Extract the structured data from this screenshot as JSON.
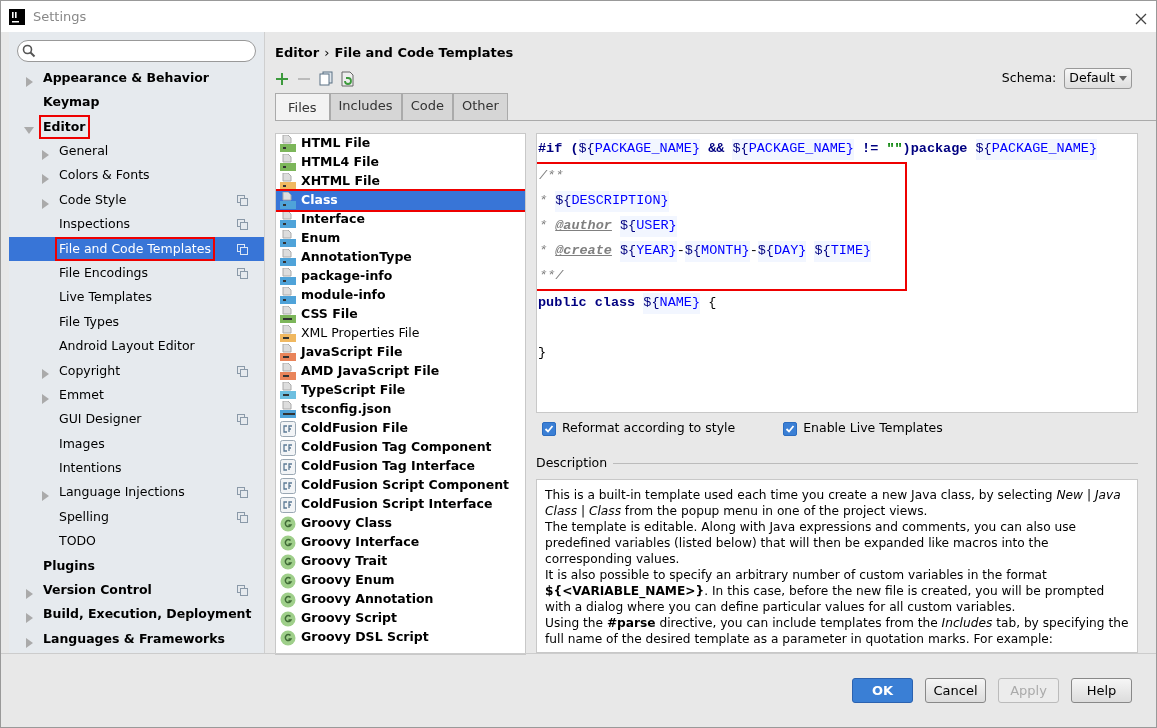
{
  "window": {
    "title": "Settings"
  },
  "sidebar": {
    "items": [
      {
        "label": "Appearance & Behavior",
        "kind": "group",
        "expanded": false,
        "project": false,
        "selected": false,
        "highlighted": false
      },
      {
        "label": "Keymap",
        "kind": "leaf",
        "project": false,
        "selected": false,
        "highlighted": false
      },
      {
        "label": "Editor",
        "kind": "group",
        "expanded": true,
        "project": false,
        "selected": false,
        "highlighted": true,
        "children": [
          {
            "label": "General",
            "kind": "group",
            "expanded": false,
            "project": false,
            "selected": false,
            "highlighted": false
          },
          {
            "label": "Colors & Fonts",
            "kind": "group",
            "expanded": false,
            "project": false,
            "selected": false,
            "highlighted": false
          },
          {
            "label": "Code Style",
            "kind": "group",
            "expanded": false,
            "project": true,
            "selected": false,
            "highlighted": false
          },
          {
            "label": "Inspections",
            "kind": "leaf",
            "project": true,
            "selected": false,
            "highlighted": false
          },
          {
            "label": "File and Code Templates",
            "kind": "leaf",
            "project": true,
            "selected": true,
            "highlighted": true
          },
          {
            "label": "File Encodings",
            "kind": "leaf",
            "project": true,
            "selected": false,
            "highlighted": false
          },
          {
            "label": "Live Templates",
            "kind": "leaf",
            "project": false,
            "selected": false,
            "highlighted": false
          },
          {
            "label": "File Types",
            "kind": "leaf",
            "project": false,
            "selected": false,
            "highlighted": false
          },
          {
            "label": "Android Layout Editor",
            "kind": "leaf",
            "project": false,
            "selected": false,
            "highlighted": false
          },
          {
            "label": "Copyright",
            "kind": "group",
            "expanded": false,
            "project": true,
            "selected": false,
            "highlighted": false
          },
          {
            "label": "Emmet",
            "kind": "group",
            "expanded": false,
            "project": false,
            "selected": false,
            "highlighted": false
          },
          {
            "label": "GUI Designer",
            "kind": "leaf",
            "project": true,
            "selected": false,
            "highlighted": false
          },
          {
            "label": "Images",
            "kind": "leaf",
            "project": false,
            "selected": false,
            "highlighted": false
          },
          {
            "label": "Intentions",
            "kind": "leaf",
            "project": false,
            "selected": false,
            "highlighted": false
          },
          {
            "label": "Language Injections",
            "kind": "group",
            "expanded": false,
            "project": true,
            "selected": false,
            "highlighted": false
          },
          {
            "label": "Spelling",
            "kind": "leaf",
            "project": true,
            "selected": false,
            "highlighted": false
          },
          {
            "label": "TODO",
            "kind": "leaf",
            "project": false,
            "selected": false,
            "highlighted": false
          }
        ]
      },
      {
        "label": "Plugins",
        "kind": "leaf",
        "project": false,
        "selected": false,
        "highlighted": false
      },
      {
        "label": "Version Control",
        "kind": "group",
        "expanded": false,
        "project": true,
        "selected": false,
        "highlighted": false
      },
      {
        "label": "Build, Execution, Deployment",
        "kind": "group",
        "expanded": false,
        "project": false,
        "selected": false,
        "highlighted": false
      },
      {
        "label": "Languages & Frameworks",
        "kind": "group",
        "expanded": false,
        "project": false,
        "selected": false,
        "highlighted": false
      }
    ]
  },
  "breadcrumb": [
    "Editor",
    "›",
    "File and Code Templates"
  ],
  "schema": {
    "label": "Schema:",
    "value": "Default"
  },
  "tabs": [
    {
      "label": "Files",
      "selected": true
    },
    {
      "label": "Includes",
      "selected": false
    },
    {
      "label": "Code",
      "selected": false
    },
    {
      "label": "Other",
      "selected": false
    }
  ],
  "templates": [
    {
      "label": "HTML File",
      "kind": "html",
      "bold": true,
      "selected": false,
      "highlighted": false
    },
    {
      "label": "HTML4 File",
      "kind": "html",
      "bold": true,
      "selected": false,
      "highlighted": false
    },
    {
      "label": "XHTML File",
      "kind": "xhtml",
      "bold": true,
      "selected": false,
      "highlighted": false
    },
    {
      "label": "Class",
      "kind": "java",
      "bold": true,
      "selected": true,
      "highlighted": true
    },
    {
      "label": "Interface",
      "kind": "java",
      "bold": true,
      "selected": false,
      "highlighted": false
    },
    {
      "label": "Enum",
      "kind": "java",
      "bold": true,
      "selected": false,
      "highlighted": false
    },
    {
      "label": "AnnotationType",
      "kind": "java",
      "bold": true,
      "selected": false,
      "highlighted": false
    },
    {
      "label": "package-info",
      "kind": "java",
      "bold": true,
      "selected": false,
      "highlighted": false
    },
    {
      "label": "module-info",
      "kind": "java",
      "bold": true,
      "selected": false,
      "highlighted": false
    },
    {
      "label": "CSS File",
      "kind": "css",
      "bold": true,
      "selected": false,
      "highlighted": false
    },
    {
      "label": "XML Properties File",
      "kind": "xml",
      "bold": false,
      "selected": false,
      "highlighted": false
    },
    {
      "label": "JavaScript File",
      "kind": "js",
      "bold": true,
      "selected": false,
      "highlighted": false
    },
    {
      "label": "AMD JavaScript File",
      "kind": "js",
      "bold": true,
      "selected": false,
      "highlighted": false
    },
    {
      "label": "TypeScript File",
      "kind": "ts",
      "bold": true,
      "selected": false,
      "highlighted": false
    },
    {
      "label": "tsconfig.json",
      "kind": "json",
      "bold": true,
      "selected": false,
      "highlighted": false
    },
    {
      "label": "ColdFusion File",
      "kind": "cf",
      "bold": true,
      "selected": false,
      "highlighted": false
    },
    {
      "label": "ColdFusion Tag Component",
      "kind": "cf",
      "bold": true,
      "selected": false,
      "highlighted": false
    },
    {
      "label": "ColdFusion Tag Interface",
      "kind": "cf",
      "bold": true,
      "selected": false,
      "highlighted": false
    },
    {
      "label": "ColdFusion Script Component",
      "kind": "cf",
      "bold": true,
      "selected": false,
      "highlighted": false
    },
    {
      "label": "ColdFusion Script Interface",
      "kind": "cf",
      "bold": true,
      "selected": false,
      "highlighted": false
    },
    {
      "label": "Groovy Class",
      "kind": "groovy",
      "bold": true,
      "selected": false,
      "highlighted": false
    },
    {
      "label": "Groovy Interface",
      "kind": "groovy",
      "bold": true,
      "selected": false,
      "highlighted": false
    },
    {
      "label": "Groovy Trait",
      "kind": "groovy",
      "bold": true,
      "selected": false,
      "highlighted": false
    },
    {
      "label": "Groovy Enum",
      "kind": "groovy",
      "bold": true,
      "selected": false,
      "highlighted": false
    },
    {
      "label": "Groovy Annotation",
      "kind": "groovy",
      "bold": true,
      "selected": false,
      "highlighted": false
    },
    {
      "label": "Groovy Script",
      "kind": "groovy",
      "bold": true,
      "selected": false,
      "highlighted": false
    },
    {
      "label": "Groovy DSL Script",
      "kind": "groovy",
      "bold": true,
      "selected": false,
      "highlighted": false
    }
  ],
  "code": {
    "lines": [
      {
        "framed": false,
        "tokens": [
          {
            "kind": "directive",
            "text": "#if ("
          },
          {
            "kind": "var",
            "text": "${PACKAGE_NAME}"
          },
          {
            "kind": "directive",
            "text": " && "
          },
          {
            "kind": "var",
            "text": "${PACKAGE_NAME}"
          },
          {
            "kind": "directive",
            "text": " != "
          },
          {
            "kind": "string",
            "text": "\"\""
          },
          {
            "kind": "directive",
            "text": ")package "
          },
          {
            "kind": "var",
            "text": "${PACKAGE_NAME}"
          }
        ]
      },
      {
        "framed": true,
        "tokens": [
          {
            "kind": "comment",
            "text": "/**"
          }
        ]
      },
      {
        "framed": true,
        "tokens": [
          {
            "kind": "comment",
            "text": "* "
          },
          {
            "kind": "var",
            "text": "${DESCRIPTION}"
          }
        ]
      },
      {
        "framed": true,
        "tokens": [
          {
            "kind": "comment",
            "text": "* "
          },
          {
            "kind": "tag",
            "text": "@author"
          },
          {
            "kind": "var",
            "text": "${USER}"
          }
        ]
      },
      {
        "framed": true,
        "tokens": [
          {
            "kind": "comment",
            "text": "* "
          },
          {
            "kind": "tag",
            "text": "@create"
          },
          {
            "kind": "var",
            "text": "${YEAR}"
          },
          {
            "kind": "plain",
            "text": "-"
          },
          {
            "kind": "var",
            "text": "${MONTH}"
          },
          {
            "kind": "plain",
            "text": "-"
          },
          {
            "kind": "var",
            "text": "${DAY}"
          },
          {
            "kind": "var",
            "text": "${TIME}"
          }
        ]
      },
      {
        "framed": true,
        "tokens": [
          {
            "kind": "comment",
            "text": "**/"
          }
        ]
      },
      {
        "framed": false,
        "tokens": [
          {
            "kind": "keyword",
            "text": "public class "
          },
          {
            "kind": "var",
            "text": "${NAME}"
          },
          {
            "kind": "plain",
            "text": " {"
          }
        ]
      },
      {
        "framed": false,
        "tokens": [
          {
            "kind": "plain",
            "text": "}"
          }
        ]
      }
    ]
  },
  "options": [
    {
      "label": "Reformat according to style",
      "checked": true
    },
    {
      "label": "Enable Live Templates",
      "checked": true
    }
  ],
  "description": {
    "title": "Description",
    "paragraphs": [
      "This is a built-in template used each time you create a new Java class, by selecting *New | Java Class | Class* from the popup menu in one of the project views.",
      "The template is editable. Along with Java expressions and comments, you can also use predefined variables (listed below) that will then be expanded like macros into the corresponding values.",
      "It is also possible to specify an arbitrary number of custom variables in the format **${<VARIABLE_NAME>}**. In this case, before the new file is created, you will be prompted with a dialog where you can define particular values for all custom variables.",
      "Using the **#parse** directive, you can include templates from the *Includes* tab, by specifying the full name of the desired template as a parameter in quotation marks. For example:"
    ]
  },
  "buttons": [
    {
      "label": "OK",
      "kind": "primary",
      "disabled": false
    },
    {
      "label": "Cancel",
      "kind": "normal",
      "disabled": false
    },
    {
      "label": "Apply",
      "kind": "normal",
      "disabled": true
    },
    {
      "label": "Help",
      "kind": "normal",
      "disabled": false
    }
  ]
}
